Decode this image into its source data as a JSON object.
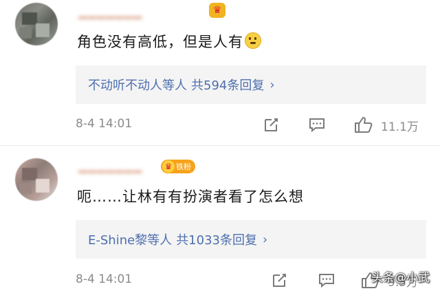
{
  "comments": [
    {
      "username": "▁▁▁▁▁▁▁",
      "badge": "♛",
      "text": "角色没有高低，但是人有",
      "reply_preview": {
        "users": "不动听不动人等人",
        "count": "共594条回复",
        "chevron": "›"
      },
      "time": "8-4 14:01",
      "like_count": "11.1万"
    },
    {
      "username": "▁▁▁▁▁▁▁",
      "badge": "♛",
      "fan_badge": "铁粉",
      "text": "呃……让林有有扮演者看了怎么想",
      "reply_preview": {
        "users": "E-Shine黎等人",
        "count": "共1033条回复",
        "chevron": "›"
      },
      "time": "8-4 14:01",
      "like_count": "9.5万"
    }
  ],
  "watermark": "头条@小武",
  "colors": {
    "link": "#4d6fae",
    "meta": "#8a8a8a",
    "badge": "#f6a21a"
  },
  "icons": [
    "repost-icon",
    "comment-icon",
    "like-icon"
  ]
}
